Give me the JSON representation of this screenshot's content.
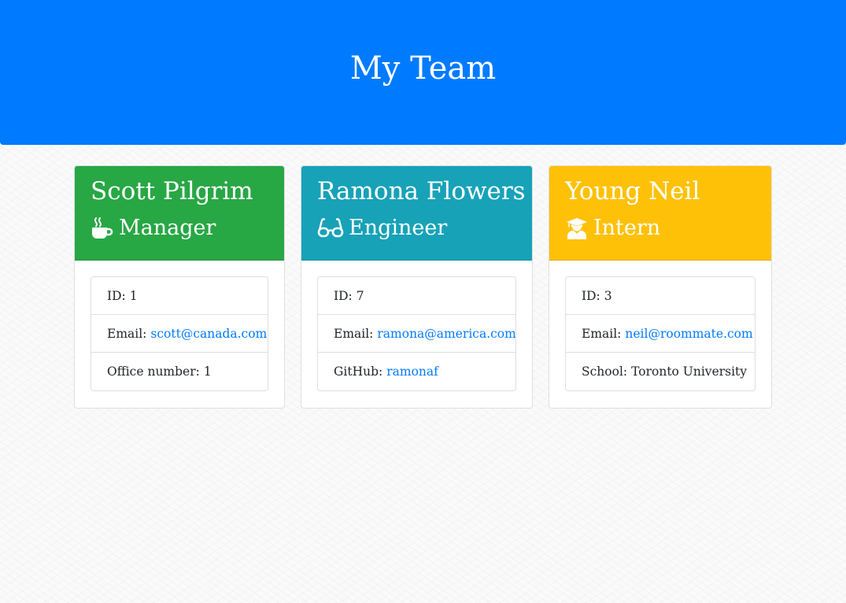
{
  "header": {
    "title": "My Team",
    "bg_color": "#007bff"
  },
  "cards": [
    {
      "name": "Scott Pilgrim",
      "role": "Manager",
      "role_icon": "coffee-mug-icon",
      "header_color": "#28a745",
      "id_label": "ID:",
      "id_value": "1",
      "email_label": "Email:",
      "email": "scott@canada.com",
      "extra_label": "Office number:",
      "extra_value": "1"
    },
    {
      "name": "Ramona Flowers",
      "role": "Engineer",
      "role_icon": "glasses-icon",
      "header_color": "#17a2b8",
      "id_label": "ID:",
      "id_value": "7",
      "email_label": "Email:",
      "email": "ramona@america.com",
      "extra_label": "GitHub:",
      "extra_value": "ramonaf"
    },
    {
      "name": "Young Neil",
      "role": "Intern",
      "role_icon": "graduate-icon",
      "header_color": "#ffc107",
      "id_label": "ID:",
      "id_value": "3",
      "email_label": "Email:",
      "email": "neil@roommate.com",
      "extra_label": "School:",
      "extra_value": "Toronto University"
    }
  ]
}
